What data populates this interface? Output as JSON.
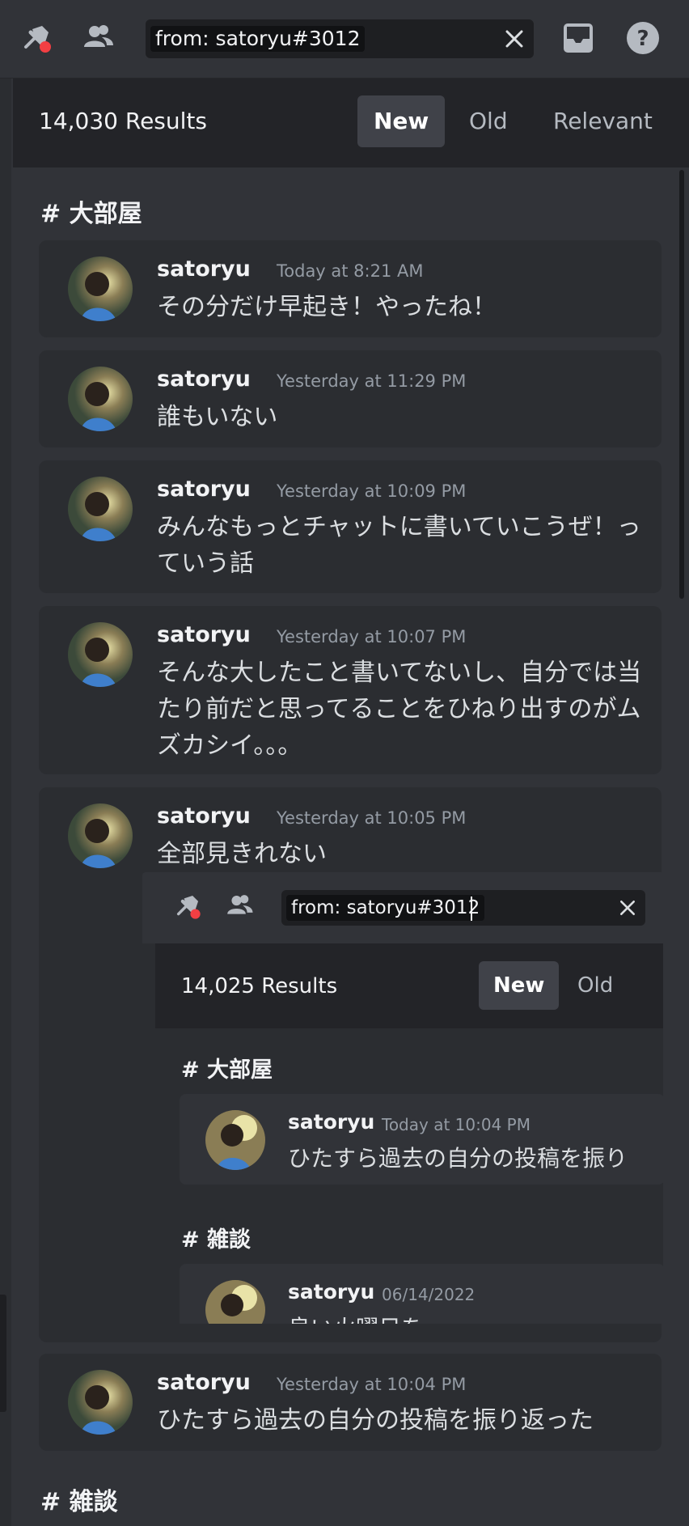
{
  "toolbar": {
    "pins_icon": "pin-icon",
    "members_icon": "members-icon",
    "search": {
      "token": "from: satoryu#3012",
      "clear_icon": "close-icon"
    },
    "inbox_icon": "inbox-icon",
    "help_icon": "help-icon"
  },
  "results": {
    "count_label": "14,030 Results",
    "sort_tabs": [
      "New",
      "Old",
      "Relevant"
    ],
    "active_tab": "New"
  },
  "groups": [
    {
      "channel": "# 大部屋",
      "messages": [
        {
          "author": "satoryu",
          "time": "Today at 8:21 AM",
          "text": "その分だけ早起き！やったね！"
        },
        {
          "author": "satoryu",
          "time": "Yesterday at 11:29 PM",
          "text": "誰もいない"
        },
        {
          "author": "satoryu",
          "time": "Yesterday at 10:09 PM",
          "text": "みんなもっとチャットに書いていこうぜ！っていう話"
        },
        {
          "author": "satoryu",
          "time": "Yesterday at 10:07 PM",
          "text": "そんな大したこと書いてないし、自分では当たり前だと思ってることをひねり出すのがムズカシイ。。。"
        },
        {
          "author": "satoryu",
          "time": "Yesterday at 10:05 PM",
          "text": "全部見きれない"
        },
        {
          "author": "satoryu",
          "time": "Yesterday at 10:04 PM",
          "text": "ひたすら過去の自分の投稿を振り返った"
        }
      ]
    },
    {
      "channel": "# 雑談"
    }
  ],
  "embed": {
    "search_token": "from: satoryu#3012",
    "count_label": "14,025 Results",
    "sort_tabs": [
      "New",
      "Old"
    ],
    "groups": [
      {
        "channel": "# 大部屋",
        "author": "satoryu",
        "time": "Today at 10:04 PM",
        "text": "ひたすら過去の自分の投稿を振り"
      },
      {
        "channel": "# 雑談",
        "author": "satoryu",
        "time": "06/14/2022",
        "text": "良い火曜日を"
      }
    ]
  },
  "colors": {
    "background": "#313338",
    "card": "#2b2d31",
    "header": "#232428",
    "notification_dot": "#f23f43"
  }
}
